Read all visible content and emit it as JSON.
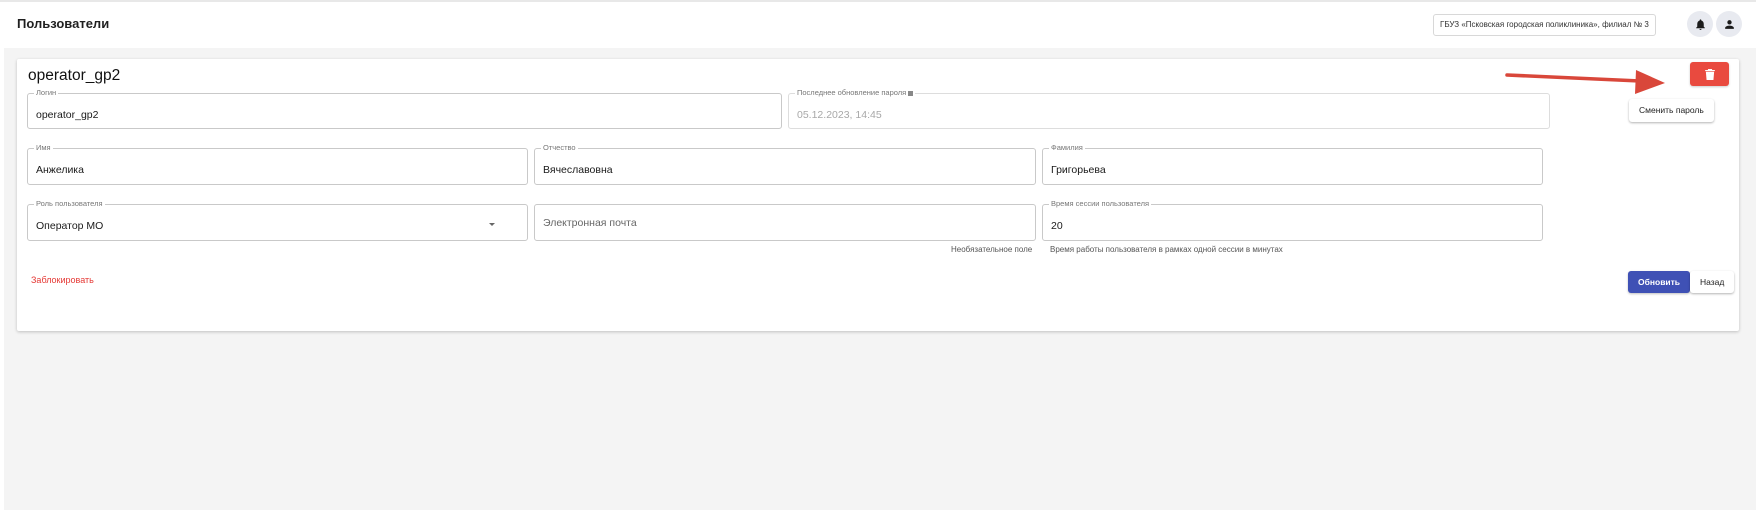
{
  "header": {
    "title": "Пользователи",
    "organization": "ГБУЗ «Псковская городская поликлиника», филиал № 3",
    "bell_icon": "bell-icon",
    "account_icon": "account-icon"
  },
  "card": {
    "title": "operator_gp2",
    "login": {
      "label": "Логин",
      "value": "operator_gp2"
    },
    "password_update": {
      "label": "Последнее обновление пароля",
      "value": "05.12.2023, 14:45",
      "change_button": "Сменить пароль"
    },
    "first_name": {
      "label": "Имя",
      "value": "Анжелика"
    },
    "patronymic": {
      "label": "Отчество",
      "value": "Вячеславовна"
    },
    "last_name": {
      "label": "Фамилия",
      "value": "Григорьева"
    },
    "role": {
      "label": "Роль пользователя",
      "value": "Оператор МО"
    },
    "email": {
      "placeholder": "Электронная почта",
      "hint": "Необязательное поле"
    },
    "session_time": {
      "label": "Время сессии пользователя",
      "value": "20",
      "hint": "Время работы пользователя в рамках одной сессии в минутах"
    },
    "block_link": "Заблокировать",
    "update_button": "Обновить",
    "back_button": "Назад",
    "delete_icon": "trash-icon"
  },
  "colors": {
    "primary": "#3f51b5",
    "danger": "#e94a3f",
    "annotation": "#d9473a",
    "background": "#f4f4f4"
  }
}
